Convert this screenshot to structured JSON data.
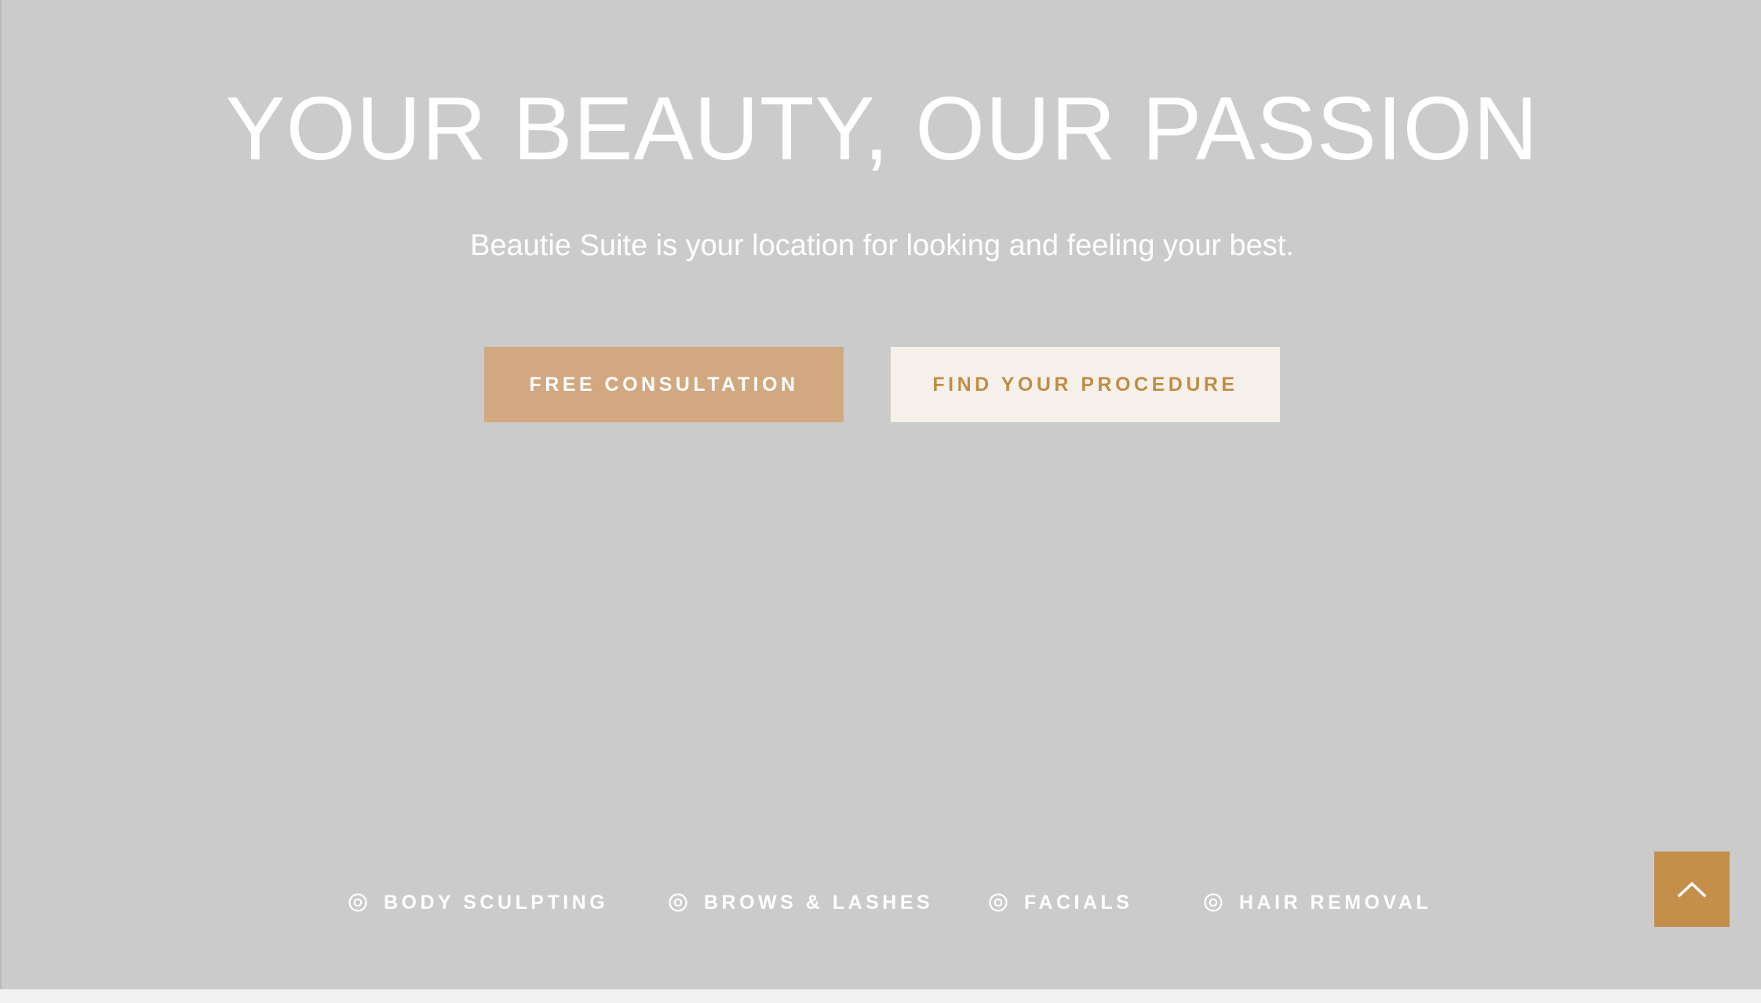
{
  "hero": {
    "headline": "YOUR BEAUTY, OUR PASSION",
    "subtitle": "Beautie Suite is your location for looking and feeling your best."
  },
  "buttons": {
    "primary_label": "FREE CONSULTATION",
    "secondary_label": "FIND YOUR PROCEDURE"
  },
  "categories": [
    {
      "label": "BODY SCULPTING",
      "icon": "target-icon"
    },
    {
      "label": "BROWS & LASHES",
      "icon": "target-icon"
    },
    {
      "label": "FACIALS",
      "icon": "target-icon"
    },
    {
      "label": "HAIR REMOVAL",
      "icon": "target-icon"
    }
  ],
  "scroll_top": {
    "icon": "chevron-up-icon"
  },
  "colors": {
    "background": "#cbcbcb",
    "primary_button": "#d1a880",
    "secondary_button": "#f5f1ea",
    "secondary_button_text": "#c08d45",
    "accent": "#c38f4a",
    "text": "#ffffff"
  }
}
